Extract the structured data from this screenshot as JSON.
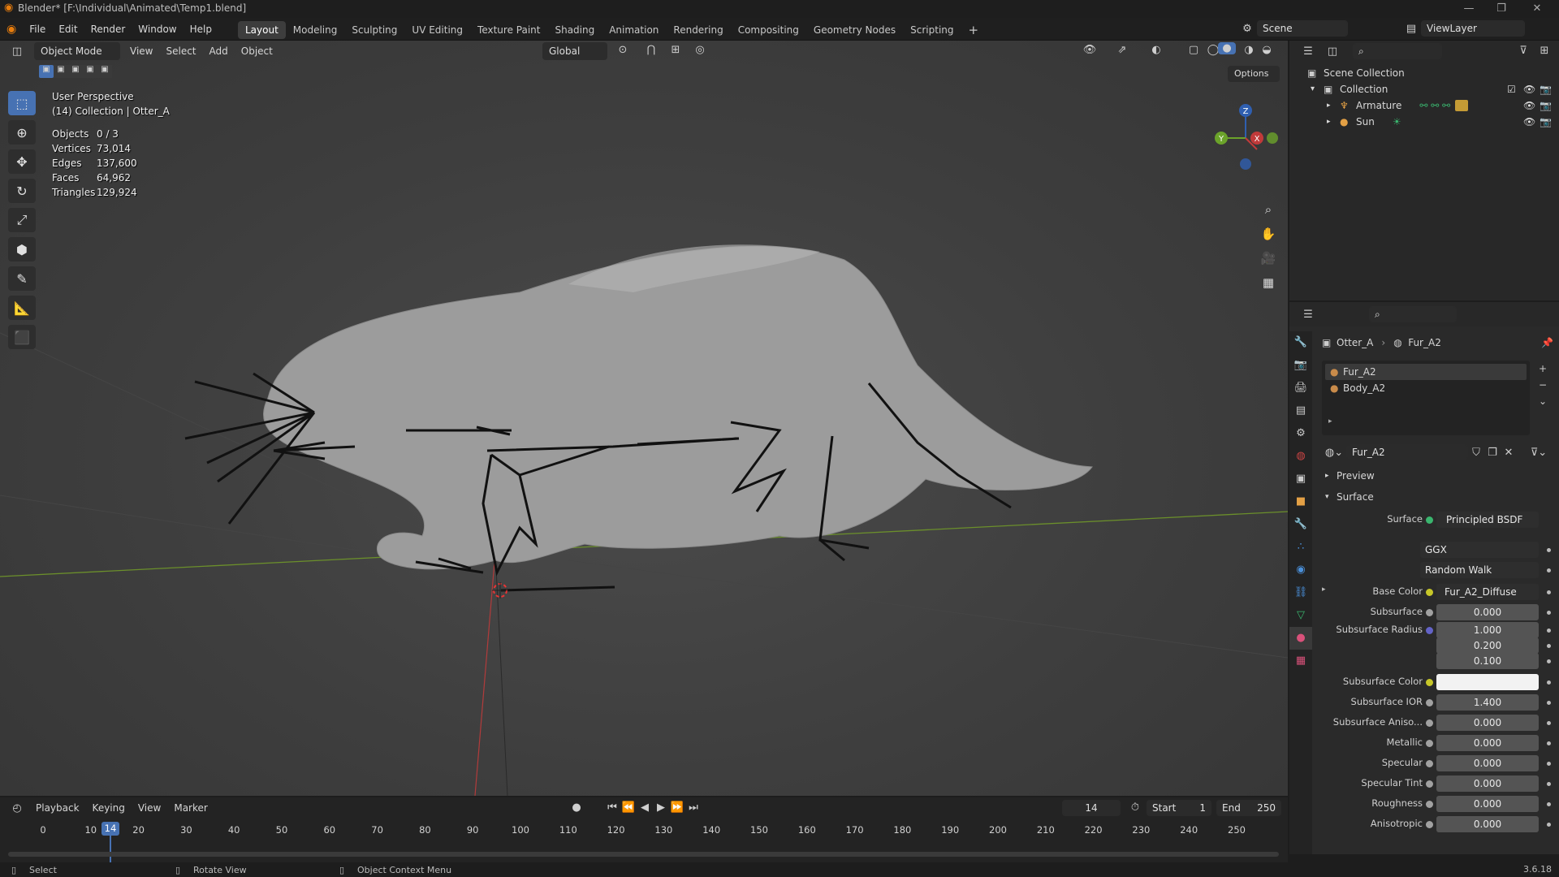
{
  "window": {
    "title": "Blender* [F:\\Individual\\Animated\\Temp1.blend]",
    "version": "3.6.18"
  },
  "menus": [
    "File",
    "Edit",
    "Render",
    "Window",
    "Help"
  ],
  "workspaces": [
    "Layout",
    "Modeling",
    "Sculpting",
    "UV Editing",
    "Texture Paint",
    "Shading",
    "Animation",
    "Rendering",
    "Compositing",
    "Geometry Nodes",
    "Scripting"
  ],
  "active_workspace": "Layout",
  "scene": {
    "name": "Scene",
    "view_layer": "ViewLayer"
  },
  "viewport": {
    "mode": "Object Mode",
    "header_menus": [
      "View",
      "Select",
      "Add",
      "Object"
    ],
    "orientation": "Global",
    "options_label": "Options",
    "perspective": "User Perspective",
    "collection_info": "(14) Collection | Otter_A",
    "stats": [
      {
        "label": "Objects",
        "value": "0 / 3"
      },
      {
        "label": "Vertices",
        "value": "73,014"
      },
      {
        "label": "Edges",
        "value": "137,600"
      },
      {
        "label": "Faces",
        "value": "64,962"
      },
      {
        "label": "Triangles",
        "value": "129,924"
      }
    ],
    "gizmo_axes": [
      "Z",
      "Y",
      "X"
    ]
  },
  "outliner": {
    "root": "Scene Collection",
    "collection": "Collection",
    "items": [
      "Armature",
      "Sun"
    ]
  },
  "properties": {
    "breadcrumb_object": "Otter_A",
    "breadcrumb_material": "Fur_A2",
    "material_slots": [
      "Fur_A2",
      "Body_A2"
    ],
    "material_name": "Fur_A2",
    "panels": {
      "preview": "Preview",
      "surface": "Surface"
    },
    "surface_label": "Surface",
    "surface_shader": "Principled BSDF",
    "distribution": "GGX",
    "subsurface_method": "Random Walk",
    "fields": [
      {
        "label": "Base Color",
        "value": "Fur_A2_Diffuse",
        "kind": "link",
        "dot": "#c7c729"
      },
      {
        "label": "Subsurface",
        "value": "0.000",
        "kind": "num",
        "dot": "#a1a1a1"
      },
      {
        "label": "Subsurface Radius",
        "value": "1.000",
        "kind": "num",
        "dot": "#6363c7"
      },
      {
        "label": "",
        "value": "0.200",
        "kind": "num",
        "dot": ""
      },
      {
        "label": "",
        "value": "0.100",
        "kind": "num",
        "dot": ""
      },
      {
        "label": "Subsurface Color",
        "value": "",
        "kind": "color",
        "dot": "#c7c729"
      },
      {
        "label": "Subsurface IOR",
        "value": "1.400",
        "kind": "num",
        "dot": "#a1a1a1"
      },
      {
        "label": "Subsurface Aniso...",
        "value": "0.000",
        "kind": "num",
        "dot": "#a1a1a1"
      },
      {
        "label": "Metallic",
        "value": "0.000",
        "kind": "num",
        "dot": "#a1a1a1"
      },
      {
        "label": "Specular",
        "value": "0.000",
        "kind": "num",
        "dot": "#a1a1a1"
      },
      {
        "label": "Specular Tint",
        "value": "0.000",
        "kind": "num",
        "dot": "#a1a1a1"
      },
      {
        "label": "Roughness",
        "value": "0.000",
        "kind": "num",
        "dot": "#a1a1a1"
      },
      {
        "label": "Anisotropic",
        "value": "0.000",
        "kind": "num",
        "dot": "#a1a1a1"
      }
    ]
  },
  "timeline": {
    "menus": [
      "Playback",
      "Keying",
      "View",
      "Marker"
    ],
    "current_frame": "14",
    "start_label": "Start",
    "start": "1",
    "end_label": "End",
    "end": "250",
    "ticks": [
      "0",
      "10",
      "20",
      "30",
      "40",
      "50",
      "60",
      "70",
      "80",
      "90",
      "100",
      "110",
      "120",
      "130",
      "140",
      "150",
      "160",
      "170",
      "180",
      "190",
      "200",
      "210",
      "220",
      "230",
      "240",
      "250"
    ]
  },
  "statusbar": {
    "select": "Select",
    "rotate": "Rotate View",
    "context": "Object Context Menu"
  }
}
